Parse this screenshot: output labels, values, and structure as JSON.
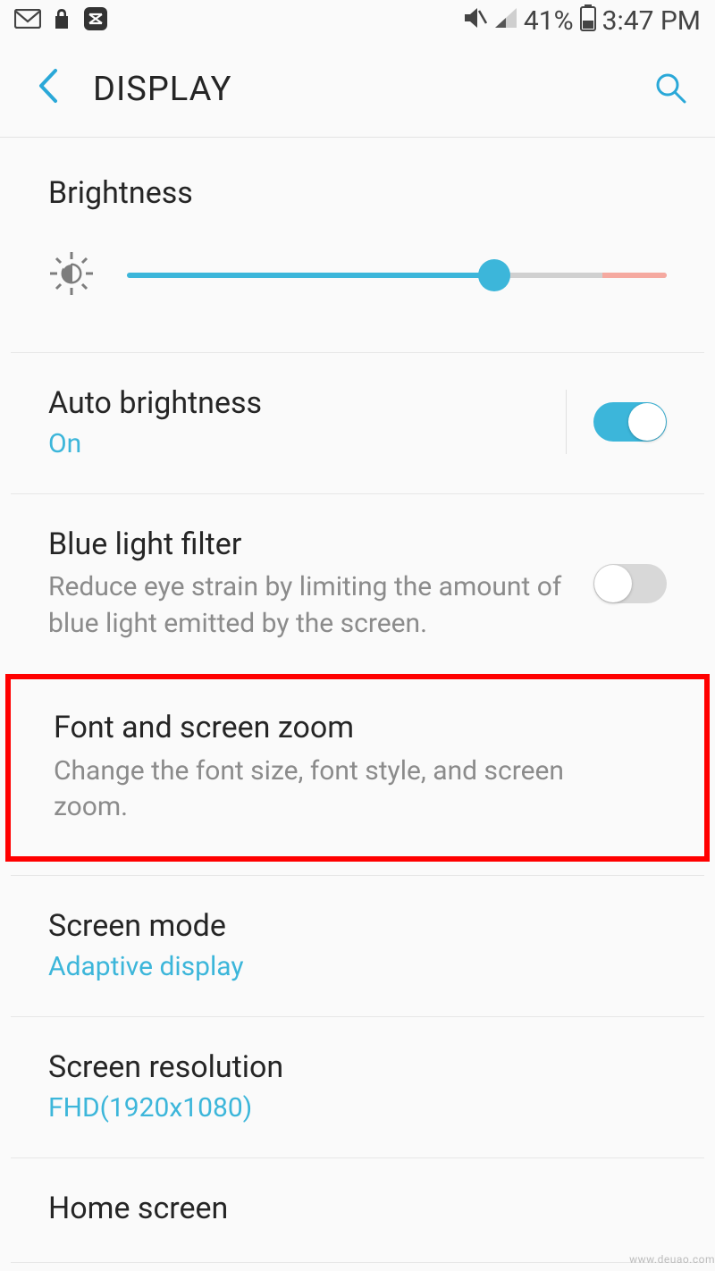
{
  "status_bar": {
    "battery_percent": "41%",
    "time": "3:47 PM"
  },
  "header": {
    "title": "DISPLAY"
  },
  "brightness": {
    "label": "Brightness",
    "slider_percent": 68,
    "warn_start_percent": 88
  },
  "auto_brightness": {
    "title": "Auto brightness",
    "state_label": "On",
    "enabled": true
  },
  "blue_light": {
    "title": "Blue light filter",
    "desc": "Reduce eye strain by limiting the amount of blue light emitted by the screen.",
    "enabled": false
  },
  "font_zoom": {
    "title": "Font and screen zoom",
    "desc": "Change the font size, font style, and screen zoom."
  },
  "screen_mode": {
    "title": "Screen mode",
    "value": "Adaptive display"
  },
  "screen_resolution": {
    "title": "Screen resolution",
    "value": "FHD(1920x1080)"
  },
  "home_screen": {
    "title": "Home screen"
  },
  "watermark": "www.deuao.com"
}
